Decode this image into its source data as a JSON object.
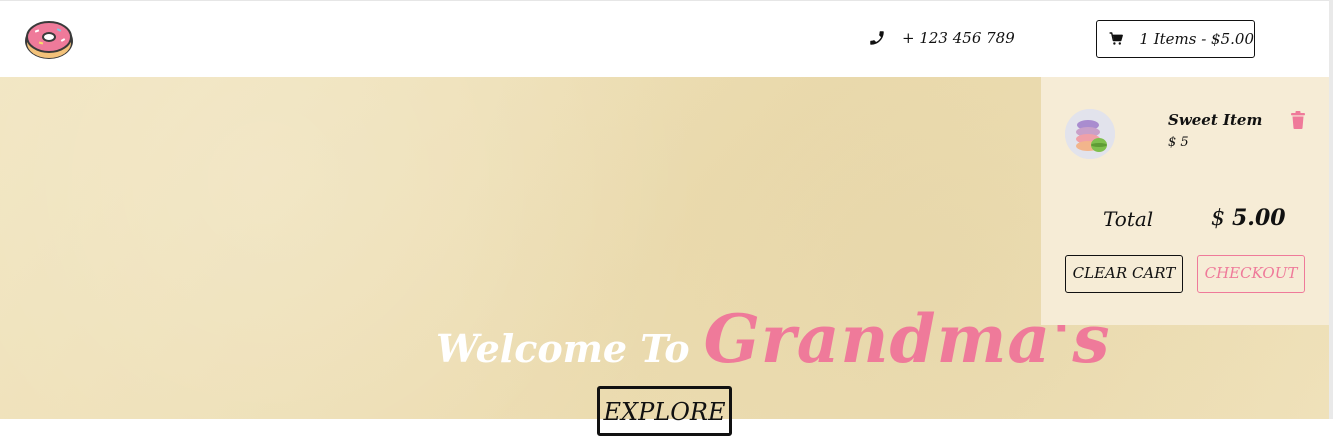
{
  "navbar": {
    "phone": "+ 123 456 789",
    "cart_summary": "1 Items - $5.00"
  },
  "hero": {
    "welcome": "Welcome To",
    "brand": "Grandma's",
    "explore": "EXPLORE"
  },
  "cart": {
    "items": [
      {
        "title": "Sweet Item",
        "price": "$ 5"
      }
    ],
    "total_label": "Total",
    "total_currency": "$",
    "total_value": "5.00",
    "clear_label": "CLEAR CART",
    "checkout_label": "CHECKOUT"
  },
  "colors": {
    "accent_pink": "#ef7a9a",
    "hero_bg": "#efe3bd",
    "cart_panel_bg": "#f6ecd6"
  },
  "icons": [
    "donut-logo-icon",
    "phone-icon",
    "cart-icon",
    "trash-icon"
  ]
}
